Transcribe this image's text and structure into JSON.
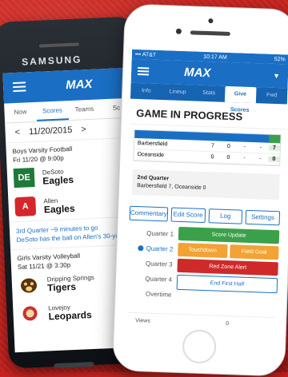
{
  "android": {
    "brand": "SAMSUNG",
    "logo": "MAX",
    "tabs": [
      "Now",
      "Scores",
      "Teams",
      "Sc"
    ],
    "active_tab": 1,
    "date_nav": {
      "prev": "<",
      "date": "11/20/2015",
      "next": ">"
    },
    "events": [
      {
        "title": "Boys Varsity Football",
        "time": "Fri 11/20 @ 9:00p",
        "teams": [
          {
            "school": "DeSoto",
            "mascot": "Eagles",
            "logo": "DE"
          },
          {
            "school": "Allen",
            "mascot": "Eagles",
            "logo": "A"
          }
        ],
        "status": [
          "3rd Quarter ~9 minutes to go",
          "DeSoto has the ball on Allen's 30-yard"
        ]
      },
      {
        "title": "Girls Varsity Volleyball",
        "time": "Sat 11/21 @ 3:30p",
        "teams": [
          {
            "school": "Dripping Springs",
            "mascot": "Tigers",
            "logo": ""
          },
          {
            "school": "Lovejoy",
            "mascot": "Leopards",
            "logo": ""
          }
        ]
      }
    ]
  },
  "iphone": {
    "status": {
      "left": "••• AT&T",
      "time": "10:17 AM",
      "right": "52%"
    },
    "logo": "MAX",
    "tabs": [
      "Info",
      "Lineup",
      "Stats",
      "Give Scores",
      "Fwd"
    ],
    "active_tab": 3,
    "title": "GAME IN PROGRESS",
    "scoreboard": {
      "rows": [
        {
          "team": "Barbersfield",
          "q": [
            "7",
            "0",
            "-",
            "-"
          ],
          "total": "7"
        },
        {
          "team": "Oceanside",
          "q": [
            "0",
            "0",
            "-",
            "-"
          ],
          "total": "0"
        }
      ]
    },
    "quarter_info": {
      "label": "2nd Quarter",
      "detail": "Barbersfield 7, Oceanside 0"
    },
    "buttons": [
      "Commentary",
      "Edit Score",
      "Log",
      "Settings"
    ],
    "periods": [
      "Quarter 1",
      "Quarter 2",
      "Quarter 3",
      "Quarter 4",
      "Overtime"
    ],
    "selected_period": 1,
    "actions": {
      "score_update": "Score Update",
      "orange_left": "Touchdown",
      "orange_right": "Field Goal",
      "red_zone": "Red Zone Alert",
      "end_half": "End First Half"
    },
    "views": {
      "label": "Views",
      "value": "0"
    }
  },
  "colors": {
    "brand_blue": "#1a6fc4",
    "green": "#3aa14a",
    "orange": "#f2a333",
    "red": "#cf2a2a",
    "background_red": "#c8231f"
  }
}
